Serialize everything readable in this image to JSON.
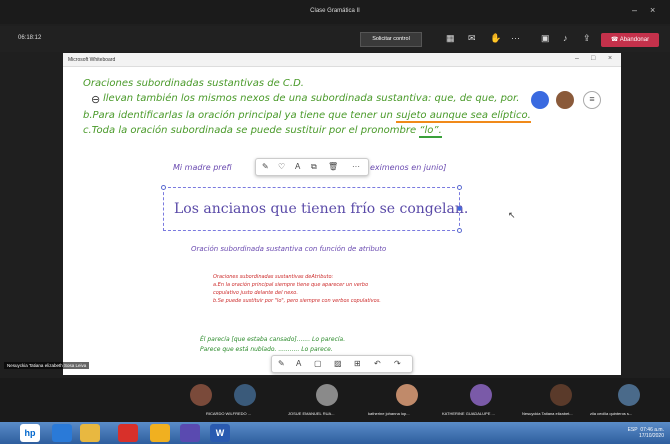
{
  "titlebar": {
    "title": "Clase Gramática II",
    "minimize": "–",
    "close": "×"
  },
  "toolbar": {
    "timer": "06:18:12",
    "request_control": "Solicitar control",
    "leave": "Abandonar"
  },
  "whiteboard": {
    "window_title": "Microsoft Whiteboard",
    "heading": "Oraciones subordinadas sustantivas de C.D.",
    "line_a": "llevan también los mismos nexos de una subordinada sustantiva: que, de que, por.",
    "line_b_prefix": "b.Para identificarlas la oración principal ya tiene que tener un ",
    "line_b_underlined": "sujeto aunque sea elíptico.",
    "line_c_prefix": "c.Toda la oración subordinada se puede sustituir por el pronombre ",
    "line_c_quoted": "“lo”.",
    "mi_madre_left": "Mi madre prefi",
    "mi_madre_right": "eximenos en junio]",
    "main_sentence": "Los ancianos que tienen frío se congelan.",
    "attr_heading": "Oración subordinada sustantiva con función de atributo",
    "red_1": "Oraciones subordinadas sustantivas deAtributo:",
    "red_2": "a.En la oración principal siempre tiene que aparecer un verbo",
    "red_3": "copulativo justo delante del nexo.",
    "red_4": "b.Se puede sustituir por \"lo\", pero siempre con verbos copulativos.",
    "green_1": "Él parecía [que estaba cansado]....... Lo parecía.",
    "green_2": "Parece que está nublado. ........... Lo parece."
  },
  "presenter": "Nesuyckia Tatiana elizabeth Sosa Leiva",
  "participants": [
    {
      "name": "",
      "color": "#7a4a3a"
    },
    {
      "name": "RICARDO WILFREDO ...",
      "color": "#3a5a7a"
    },
    {
      "name": "JOSUE EMANUEL RUA...",
      "color": "#8a8a8a"
    },
    {
      "name": "katherine johanna lop...",
      "color": "#c08a6a"
    },
    {
      "name": "KATHERINE GUADALUPE ...",
      "color": "#7a5aa8"
    },
    {
      "name": "Nesuyckia Tatiana elizabet...",
      "color": "#5a3a2a"
    },
    {
      "name": "zila cecilia quinteros s...",
      "color": "#4a6a8a"
    }
  ],
  "tray": {
    "lang": "ESP",
    "time": "07:46 a.m.",
    "date": "17/10/2020"
  },
  "colors": {
    "leave": "#c4314b",
    "ink_green": "#4a9a2a",
    "ink_purple": "#6a4ab0",
    "ink_red": "#cc2a2a"
  },
  "icons": [
    "gear-icon",
    "pen-icon",
    "undo-icon",
    "redo-icon",
    "ellipsis-icon",
    "pencil-icon"
  ]
}
